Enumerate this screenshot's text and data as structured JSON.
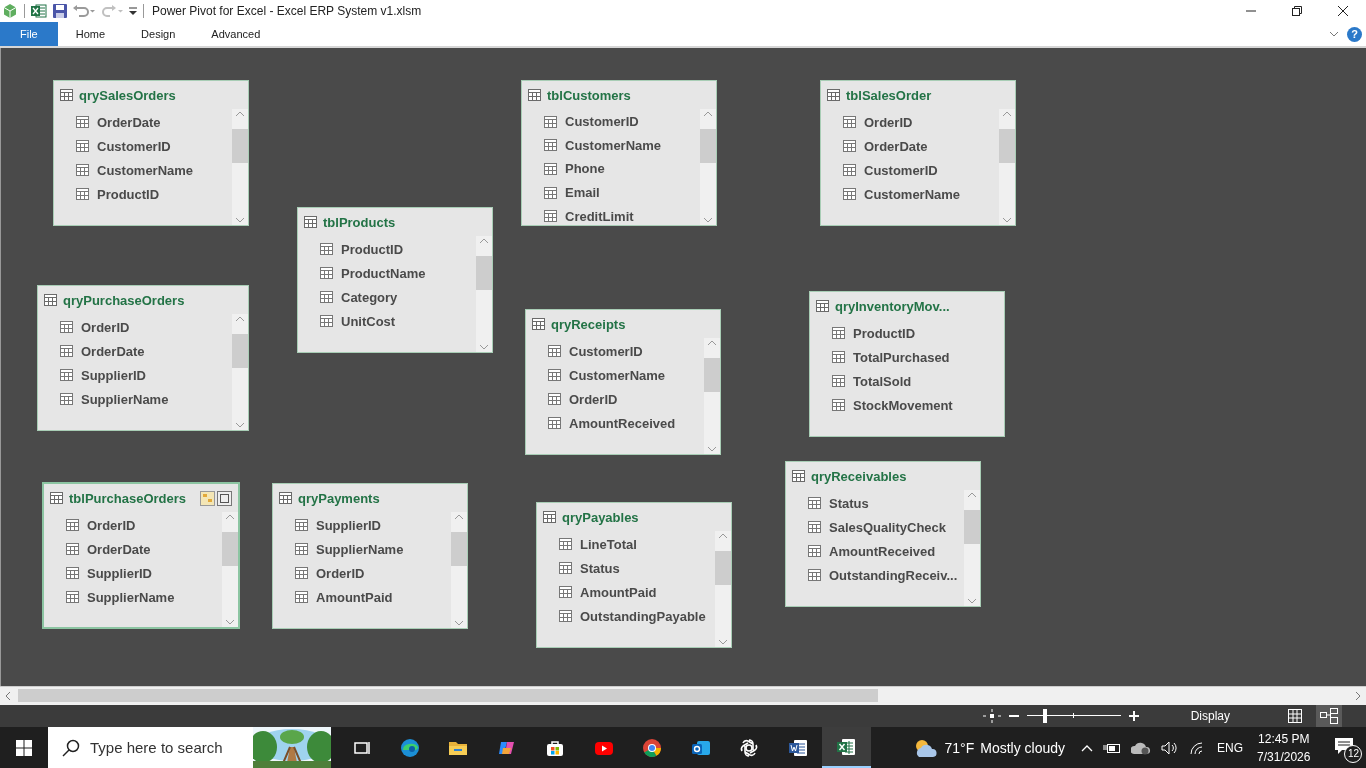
{
  "window": {
    "title": "Power Pivot for Excel - Excel ERP System v1.xlsm",
    "help": "?"
  },
  "ribbon_tabs": [
    {
      "label": "File",
      "selected": true
    },
    {
      "label": "Home",
      "selected": false
    },
    {
      "label": "Design",
      "selected": false
    },
    {
      "label": "Advanced",
      "selected": false
    }
  ],
  "tables": [
    {
      "name": "qrySalesOrders",
      "selected": false,
      "scrollbar": true,
      "fields": [
        "OrderDate",
        "CustomerID",
        "CustomerName",
        "ProductID"
      ]
    },
    {
      "name": "tblCustomers",
      "selected": false,
      "scrollbar": true,
      "fields": [
        "CustomerID",
        "CustomerName",
        "Phone",
        "Email",
        "CreditLimit"
      ]
    },
    {
      "name": "tblSalesOrder",
      "selected": false,
      "scrollbar": true,
      "fields": [
        "OrderID",
        "OrderDate",
        "CustomerID",
        "CustomerName"
      ]
    },
    {
      "name": "tblProducts",
      "selected": false,
      "scrollbar": true,
      "fields": [
        "ProductID",
        "ProductName",
        "Category",
        "UnitCost"
      ]
    },
    {
      "name": "qryPurchaseOrders",
      "selected": false,
      "scrollbar": true,
      "fields": [
        "OrderID",
        "OrderDate",
        "SupplierID",
        "SupplierName"
      ]
    },
    {
      "name": "qryReceipts",
      "selected": false,
      "scrollbar": true,
      "fields": [
        "CustomerID",
        "CustomerName",
        "OrderID",
        "AmountReceived"
      ]
    },
    {
      "name": "qryInventoryMov...",
      "selected": false,
      "scrollbar": false,
      "fields": [
        "ProductID",
        "TotalPurchased",
        "TotalSold",
        "StockMovement"
      ]
    },
    {
      "name": "tblPurchaseOrders",
      "selected": true,
      "scrollbar": true,
      "fields": [
        "OrderID",
        "OrderDate",
        "SupplierID",
        "SupplierName"
      ]
    },
    {
      "name": "qryPayments",
      "selected": false,
      "scrollbar": true,
      "fields": [
        "SupplierID",
        "SupplierName",
        "OrderID",
        "AmountPaid"
      ]
    },
    {
      "name": "qryPayables",
      "selected": false,
      "scrollbar": true,
      "fields": [
        "LineTotal",
        "Status",
        "AmountPaid",
        "OutstandingPayable"
      ]
    },
    {
      "name": "qryReceivables",
      "selected": false,
      "scrollbar": true,
      "fields": [
        "Status",
        "SalesQualityCheck",
        "AmountReceived",
        "OutstandingReceiv..."
      ]
    }
  ],
  "status_bar": {
    "zoom": {
      "level": 0.2
    },
    "display": "Display",
    "views": [
      {
        "selected": false
      },
      {
        "selected": true
      }
    ]
  },
  "taskbar": {
    "search": {
      "placeholder": "Type here to search"
    },
    "apps": [
      {
        "selected": false
      },
      {
        "selected": false
      },
      {
        "selected": false
      },
      {
        "selected": false
      },
      {
        "selected": false
      },
      {
        "selected": false
      },
      {
        "selected": false
      },
      {
        "selected": false
      },
      {
        "selected": false
      },
      {
        "selected": false
      },
      {
        "selected": true
      }
    ],
    "weather": {
      "temperature": "71°F",
      "condition": "Mostly cloudy"
    },
    "language": "ENG",
    "time": "12:45 PM",
    "date": "7/31/2026",
    "notifications": "12"
  }
}
